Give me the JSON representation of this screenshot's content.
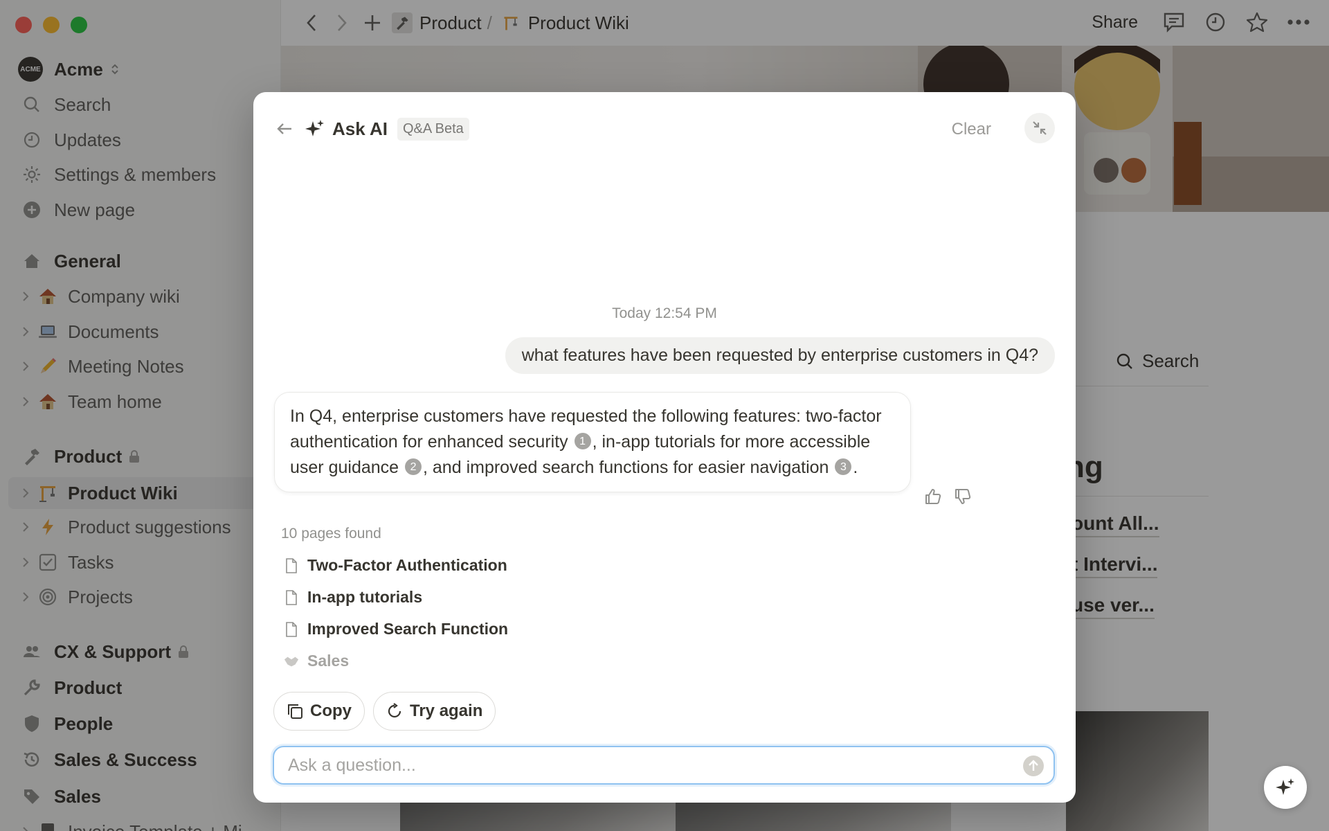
{
  "workspace": {
    "name": "Acme",
    "logo_text": "ACME"
  },
  "sidebar": {
    "top_items": [
      {
        "label": "Search",
        "icon": "search-icon"
      },
      {
        "label": "Updates",
        "icon": "clock-icon"
      },
      {
        "label": "Settings & members",
        "icon": "gear-icon"
      },
      {
        "label": "New page",
        "icon": "plus-circle-icon"
      }
    ],
    "sections": [
      {
        "title": "General",
        "icon": "home-icon",
        "locked": false,
        "items": [
          {
            "label": "Company wiki",
            "icon": "house-emoji"
          },
          {
            "label": "Documents",
            "icon": "laptop-emoji"
          },
          {
            "label": "Meeting Notes",
            "icon": "pencil-emoji"
          },
          {
            "label": "Team home",
            "icon": "house-emoji"
          }
        ]
      },
      {
        "title": "Product",
        "icon": "hammer-icon",
        "locked": true,
        "items": [
          {
            "label": "Product Wiki",
            "icon": "crane-emoji",
            "active": true
          },
          {
            "label": "Product suggestions",
            "icon": "lightning-icon"
          },
          {
            "label": "Tasks",
            "icon": "checkbox-icon"
          },
          {
            "label": "Projects",
            "icon": "target-icon"
          }
        ]
      },
      {
        "title": "CX & Support",
        "icon": "people-icon",
        "locked": true
      },
      {
        "title": "Product",
        "icon": "wrench-icon",
        "locked": false
      },
      {
        "title": "People",
        "icon": "badge-icon",
        "locked": false
      },
      {
        "title": "Sales & Success",
        "icon": "history-icon",
        "locked": false
      },
      {
        "title": "Sales",
        "icon": "tag-icon",
        "locked": false
      },
      {
        "title": "Invoice Template + Mi",
        "icon": "file-icon",
        "locked": false
      }
    ]
  },
  "topbar": {
    "breadcrumb": [
      {
        "label": "Product",
        "icon": "hammer-icon"
      },
      {
        "label": "Product Wiki",
        "icon": "crane-emoji"
      }
    ],
    "separator": "/",
    "share_label": "Share"
  },
  "background_page": {
    "search_label": "Search",
    "heading_fragment": "ng",
    "links": [
      "ount All...",
      "t Intervi...",
      "use ver..."
    ]
  },
  "ai_modal": {
    "title": "Ask AI",
    "badge": "Q&A Beta",
    "clear_label": "Clear",
    "timestamp": "Today 12:54 PM",
    "user_question": "what features have been requested by enterprise customers in Q4?",
    "answer": {
      "part1": "In Q4, enterprise customers have requested the following features: two-factor authentication for enhanced security",
      "cite1": "1",
      "part2": ", in-app tutorials for more accessible user guidance",
      "cite2": "2",
      "part3": ", and improved search functions for easier navigation",
      "cite3": "3",
      "part4": "."
    },
    "pages_found": "10 pages found",
    "sources": [
      {
        "label": "Two-Factor Authentication",
        "icon": "page-icon"
      },
      {
        "label": "In-app tutorials",
        "icon": "page-icon"
      },
      {
        "label": "Improved Search Function",
        "icon": "page-icon"
      },
      {
        "label": "Sales",
        "icon": "handshake-icon"
      }
    ],
    "copy_label": "Copy",
    "try_again_label": "Try again",
    "input_placeholder": "Ask a question..."
  },
  "colors": {
    "accent_focus": "#8fc2f0",
    "sidebar_bg": "#f7f7f5",
    "text_primary": "#37352f",
    "text_muted": "#91918e"
  }
}
